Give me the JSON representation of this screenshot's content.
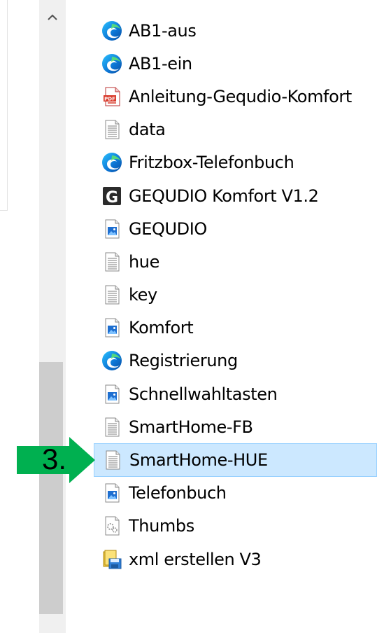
{
  "files": [
    {
      "name": "AB1-aus",
      "icon": "edge-icon"
    },
    {
      "name": "AB1-ein",
      "icon": "edge-icon"
    },
    {
      "name": "Anleitung-Gequdio-Komfort",
      "icon": "pdf-icon"
    },
    {
      "name": "data",
      "icon": "text-file-icon"
    },
    {
      "name": "Fritzbox-Telefonbuch",
      "icon": "edge-icon"
    },
    {
      "name": "GEQUDIO Komfort V1.2",
      "icon": "gequdio-app-icon"
    },
    {
      "name": "GEQUDIO",
      "icon": "image-file-icon"
    },
    {
      "name": "hue",
      "icon": "text-file-icon"
    },
    {
      "name": "key",
      "icon": "text-file-icon"
    },
    {
      "name": "Komfort",
      "icon": "image-file-icon"
    },
    {
      "name": "Registrierung",
      "icon": "edge-icon"
    },
    {
      "name": "Schnellwahltasten",
      "icon": "image-file-icon"
    },
    {
      "name": "SmartHome-FB",
      "icon": "text-file-icon"
    },
    {
      "name": "SmartHome-HUE",
      "icon": "text-file-icon",
      "selected": true
    },
    {
      "name": "Telefonbuch",
      "icon": "image-file-icon"
    },
    {
      "name": "Thumbs",
      "icon": "system-file-icon"
    },
    {
      "name": "xml erstellen V3",
      "icon": "script-file-icon"
    }
  ],
  "annotation": {
    "label": "3.",
    "color": "#00b050"
  },
  "colors": {
    "selection": "#cce8ff",
    "selection_border": "#99d1ff",
    "scrollbar": "#f0f0f0",
    "thumb": "#cdcdcd"
  }
}
